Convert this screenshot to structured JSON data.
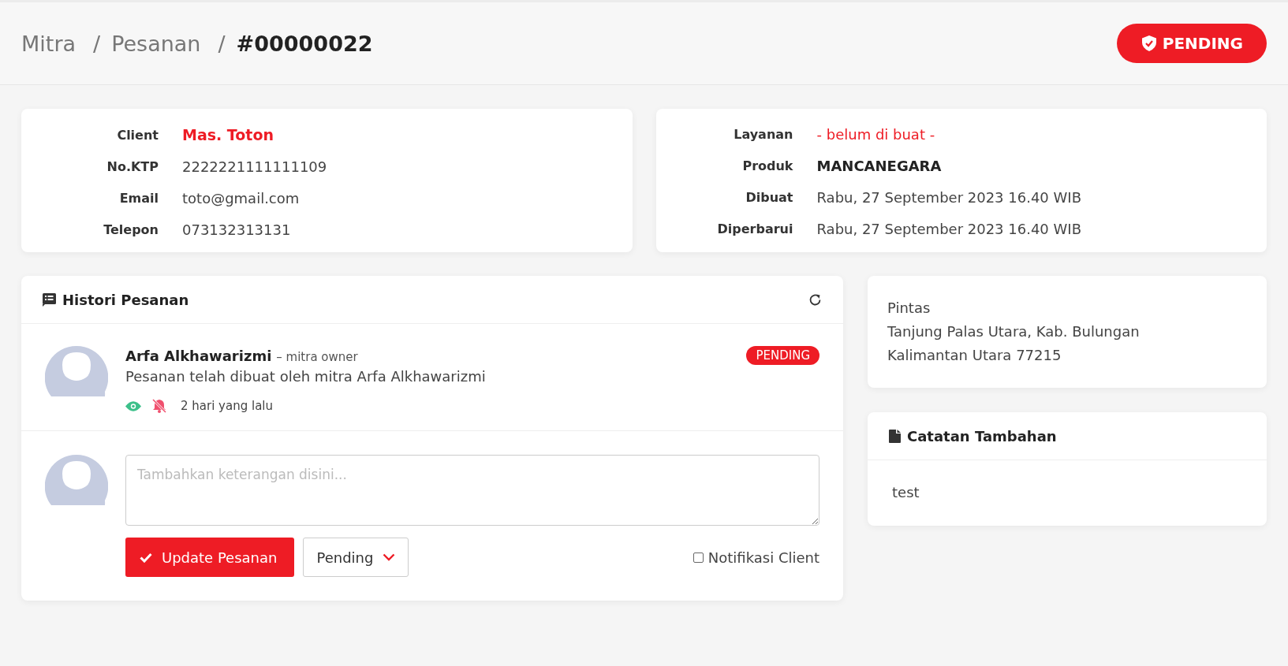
{
  "breadcrumb": [
    {
      "label": "Mitra",
      "current": false
    },
    {
      "separator": "/",
      "label": "Pesanan",
      "current": false
    },
    {
      "separator": "/",
      "label": "#00000022",
      "current": true
    }
  ],
  "status_badge": {
    "label": "PENDING"
  },
  "client_card": {
    "fields": [
      {
        "label": "Client",
        "value": "Mas. Toton",
        "kind": "name"
      },
      {
        "label": "No.KTP",
        "value": "2222221111111109",
        "kind": "plain"
      },
      {
        "label": "Email",
        "value": "toto@gmail.com",
        "kind": "plain"
      },
      {
        "label": "Telepon",
        "value": "073132313131",
        "kind": "plain"
      }
    ]
  },
  "order_card": {
    "fields": [
      {
        "label": "Layanan",
        "value": "- belum di buat -",
        "kind": "note"
      },
      {
        "label": "Produk",
        "value": "MANCANEGARA",
        "kind": "bold"
      },
      {
        "label": "Dibuat",
        "value": "Rabu, 27 September 2023 16.40 WIB",
        "kind": "plain"
      },
      {
        "label": "Diperbarui",
        "value": "Rabu, 27 September 2023 16.40 WIB",
        "kind": "plain"
      }
    ]
  },
  "history": {
    "title": "Histori Pesanan",
    "entries": [
      {
        "author": "Arfa Alkhawarizmi",
        "role": "– mitra owner",
        "message": "Pesanan telah dibuat oleh mitra Arfa Alkhawarizmi",
        "status": "PENDING",
        "seen": true,
        "notified": false,
        "time": "2 hari yang lalu"
      }
    ],
    "form": {
      "placeholder": "Tambahkan keterangan disini...",
      "submit_label": "Update Pesanan",
      "status_select": "Pending",
      "notify": {
        "label": "Notifikasi Client",
        "checked": false
      }
    }
  },
  "address_card": {
    "lines": [
      "Pintas",
      "Tanjung Palas Utara, Kab. Bulungan",
      "Kalimantan Utara 77215"
    ]
  },
  "notes_card": {
    "title": "Catatan Tambahan",
    "text": "test"
  }
}
